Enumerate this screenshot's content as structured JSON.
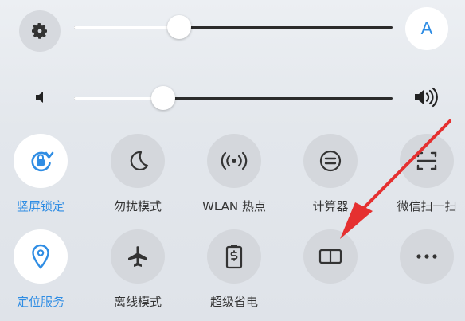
{
  "brightness": {
    "level": 0.33,
    "auto_label": "A",
    "icon": "gear-icon"
  },
  "volume": {
    "level": 0.28,
    "low_icon": "volume-low-icon",
    "high_icon": "volume-high-icon"
  },
  "tiles_row1": [
    {
      "label": "竖屏锁定",
      "icon": "rotation-lock-icon",
      "active": true
    },
    {
      "label": "勿扰模式",
      "icon": "moon-icon",
      "active": false
    },
    {
      "label": "WLAN 热点",
      "icon": "hotspot-icon",
      "active": false
    },
    {
      "label": "计算器",
      "icon": "calculator-icon",
      "active": false
    },
    {
      "label": "微信扫一扫",
      "icon": "scan-icon",
      "active": false
    }
  ],
  "tiles_row2": [
    {
      "label": "定位服务",
      "icon": "location-icon",
      "active": true
    },
    {
      "label": "离线模式",
      "icon": "airplane-icon",
      "active": false
    },
    {
      "label": "超级省电",
      "icon": "power-saving-icon",
      "active": false
    },
    {
      "label": "",
      "icon": "book-icon",
      "active": false
    },
    {
      "label": "",
      "icon": "more-icon",
      "active": false
    }
  ],
  "colors": {
    "accent": "#2f8de4",
    "arrow": "#e53030"
  }
}
